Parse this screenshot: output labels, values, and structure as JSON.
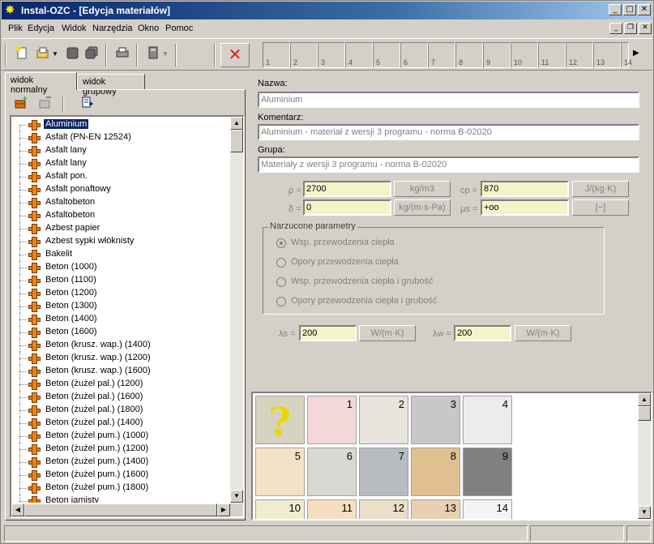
{
  "window": {
    "title": "Instal-OZC - [Edycja materiałów]",
    "controls": [
      "minimize",
      "maximize",
      "close"
    ]
  },
  "menu": [
    "Plik",
    "Edycja",
    "Widok",
    "Narzędzia",
    "Okno",
    "Pomoc"
  ],
  "toolbar": {
    "slots": [
      "1",
      "2",
      "3",
      "4",
      "5",
      "6",
      "7",
      "8",
      "9",
      "10",
      "11",
      "12",
      "13",
      "14"
    ],
    "icons": [
      "new-icon",
      "open-icon",
      "save-icon",
      "save-as-icon",
      "print-icon",
      "calculator-icon",
      "delete-icon"
    ]
  },
  "tabs": {
    "normal": "widok normalny",
    "group": "widok grupowy"
  },
  "tree": {
    "selected": "Aluminium",
    "items": [
      "Aluminium",
      "Asfalt (PN-EN 12524)",
      "Asfalt lany",
      "Asfalt lany",
      "Asfalt pon.",
      "Asfalt ponaftowy",
      "Asfaltobeton",
      "Asfaltobeton",
      "Azbest papier",
      "Azbest sypki włóknisty",
      "Bakelit",
      "Beton (1000)",
      "Beton (1100)",
      "Beton (1200)",
      "Beton (1300)",
      "Beton (1400)",
      "Beton (1600)",
      "Beton (krusz. wap.) (1400)",
      "Beton (krusz. wap.) (1200)",
      "Beton (krusz. wap.) (1600)",
      "Beton (żużel pal.) (1200)",
      "Beton (żużel pal.) (1600)",
      "Beton (żużel pal.) (1800)",
      "Beton (żużel pal.) (1400)",
      "Beton (żużel pum.) (1000)",
      "Beton (żużel pum.) (1200)",
      "Beton (żużel pum.) (1400)",
      "Beton (żużel pum.) (1600)",
      "Beton (żużel pum.) (1800)",
      "Beton jamisty"
    ]
  },
  "form": {
    "name_label": "Nazwa:",
    "name_value": "Aluminium",
    "comment_label": "Komentarz:",
    "comment_value": "Aluminium - materiał z wersji 3 programu - norma B-02020",
    "group_label": "Grupa:",
    "group_value": "Materiały z wersji 3 programu - norma B-02020",
    "rho_symbol": "ρ =",
    "rho_value": "2700",
    "rho_unit": "kg/m3",
    "cp_symbol": "cp =",
    "cp_value": "870",
    "cp_unit": "J/(kg·K)",
    "delta_symbol": "δ =",
    "delta_value": "0",
    "delta_unit": "kg/(m·s·Pa)",
    "mu_symbol": "μs =",
    "mu_value": "+oo",
    "mu_unit": "[−]",
    "params_title": "Narzucone parametry",
    "radios": [
      "Wsp. przewodzenia ciepła",
      "Opory przewodzenia ciepła",
      "Wsp. przewodzenia ciepła i grubość",
      "Opory przewodzenia ciepła i grubość"
    ],
    "radio_selected": 0,
    "lambda_s_symbol": "λs =",
    "lambda_s_value": "200",
    "lambda_s_unit": "W/(m·K)",
    "lambda_w_symbol": "λw =",
    "lambda_w_value": "200",
    "lambda_w_unit": "W/(m·K)"
  },
  "swatches": [
    {
      "label": "",
      "color": "#d6d2c0",
      "unknown": true
    },
    {
      "label": "1",
      "color": "#f2d8d8"
    },
    {
      "label": "2",
      "color": "#e8e4dc"
    },
    {
      "label": "3",
      "color": "#c8c8c8"
    },
    {
      "label": "4",
      "color": "#ececec"
    },
    {
      "label": "5",
      "color": "#f4e2c8"
    },
    {
      "label": "6",
      "color": "#d8d8d4"
    },
    {
      "label": "7",
      "color": "#b8bcc0"
    },
    {
      "label": "8",
      "color": "#e0c090"
    },
    {
      "label": "9",
      "color": "#808080"
    },
    {
      "label": "10",
      "color": "#f0ecd0"
    },
    {
      "label": "11",
      "color": "#f4e0c0"
    },
    {
      "label": "12",
      "color": "#e8e0c8"
    },
    {
      "label": "13",
      "color": "#e8d0b0"
    },
    {
      "label": "14",
      "color": "#f4f4f4"
    }
  ]
}
